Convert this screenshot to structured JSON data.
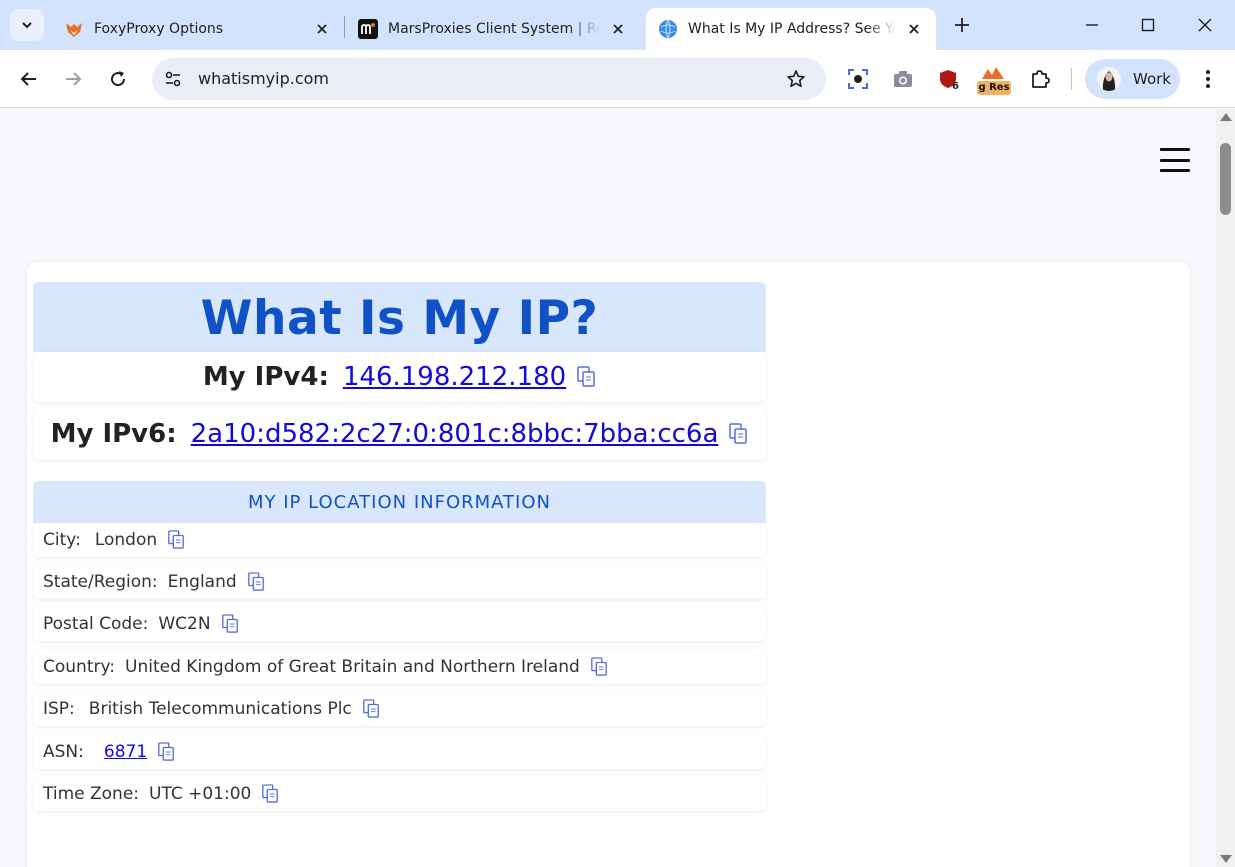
{
  "browser": {
    "tabs": [
      {
        "title": "FoxyProxy Options",
        "active": false
      },
      {
        "title": "MarsProxies Client System | Res",
        "active": false
      },
      {
        "title": "What Is My IP Address? See You",
        "active": true
      }
    ],
    "url": "whatismyip.com",
    "extensions": {
      "shield_badge": "6",
      "res_label": "g Res"
    },
    "profile_label": "Work"
  },
  "page": {
    "title": "What Is My IP?",
    "ipv4_label": "My IPv4:",
    "ipv4_value": "146.198.212.180",
    "ipv6_label": "My IPv6:",
    "ipv6_value": "2a10:d582:2c27:0:801c:8bbc:7bba:cc6a",
    "location_header": "MY IP LOCATION INFORMATION",
    "location_rows": [
      {
        "label": "City:",
        "value": "London"
      },
      {
        "label": "State/Region:",
        "value": "England"
      },
      {
        "label": "Postal Code:",
        "value": "WC2N"
      },
      {
        "label": "Country:",
        "value": "United Kingdom of Great Britain and Northern Ireland"
      },
      {
        "label": "ISP:",
        "value": "British Telecommunications Plc"
      },
      {
        "label": "ASN:",
        "value": "6871"
      },
      {
        "label": "Time Zone:",
        "value": "UTC +01:00"
      }
    ]
  },
  "colors": {
    "accent_blue": "#1151c8",
    "link_blue": "#1508d8",
    "header_bg": "#d8e7fc",
    "tabstrip_bg": "#d3e3fd"
  }
}
